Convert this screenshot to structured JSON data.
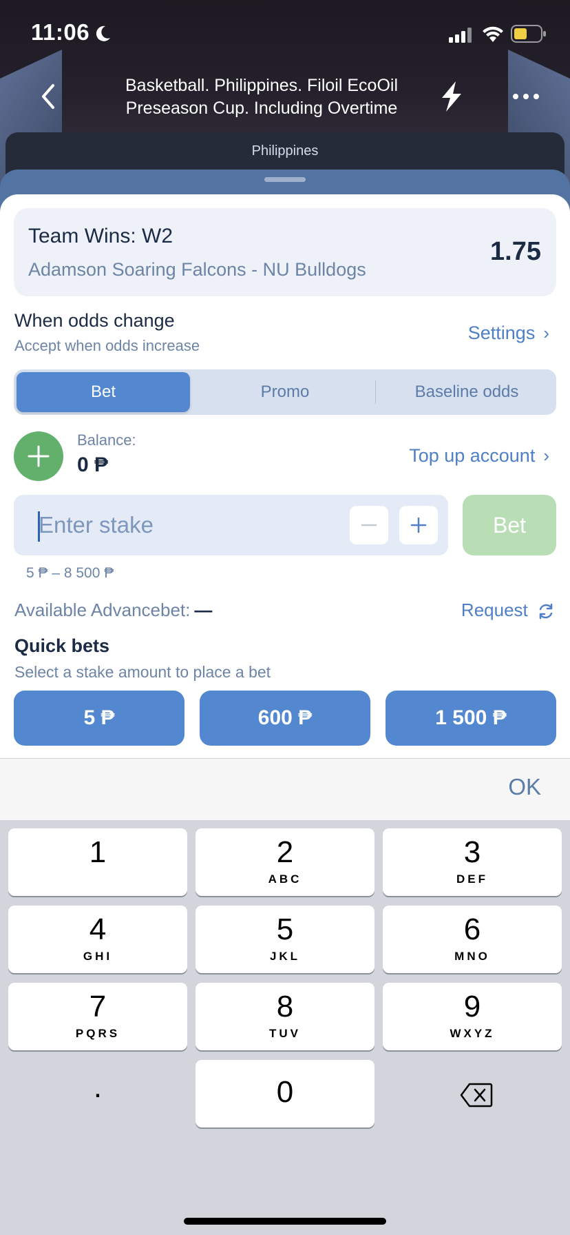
{
  "status_bar": {
    "time": "11:06"
  },
  "nav": {
    "title": "Basketball. Philippines. Filoil EcoOil Preseason Cup. Including Overtime"
  },
  "sub_header": {
    "label": "Philippines"
  },
  "bet_card": {
    "title": "Team Wins: W2",
    "teams": "Adamson Soaring Falcons - NU Bulldogs",
    "odds": "1.75"
  },
  "odds_change": {
    "title": "When odds change",
    "subtitle": "Accept when odds increase",
    "settings_label": "Settings"
  },
  "tabs": [
    {
      "label": "Bet",
      "active": true
    },
    {
      "label": "Promo",
      "active": false
    },
    {
      "label": "Baseline odds",
      "active": false
    }
  ],
  "balance": {
    "label": "Balance:",
    "value": "0 ₱",
    "top_up_label": "Top up account"
  },
  "stake": {
    "placeholder": "Enter stake",
    "range": "5 ₱ – 8 500 ₱",
    "bet_label": "Bet"
  },
  "advancebet": {
    "label": "Available Advancebet:",
    "value": "—",
    "request_label": "Request"
  },
  "quick_bets": {
    "title": "Quick bets",
    "subtitle": "Select a stake amount to place a bet",
    "amounts": [
      "5 ₱",
      "600 ₱",
      "1 500 ₱"
    ]
  },
  "keyboard": {
    "ok_label": "OK",
    "keys": [
      {
        "num": "1",
        "letters": ""
      },
      {
        "num": "2",
        "letters": "ABC"
      },
      {
        "num": "3",
        "letters": "DEF"
      },
      {
        "num": "4",
        "letters": "GHI"
      },
      {
        "num": "5",
        "letters": "JKL"
      },
      {
        "num": "6",
        "letters": "MNO"
      },
      {
        "num": "7",
        "letters": "PQRS"
      },
      {
        "num": "8",
        "letters": "TUV"
      },
      {
        "num": "9",
        "letters": "WXYZ"
      }
    ],
    "dot": ".",
    "zero": "0"
  },
  "colors": {
    "accent": "#5388d0",
    "link": "#4f7fc6",
    "balance_plus": "#62b06b",
    "bet_button_disabled": "#b9deb6",
    "text_primary": "#1b2b44",
    "text_secondary": "#6d84a6"
  }
}
